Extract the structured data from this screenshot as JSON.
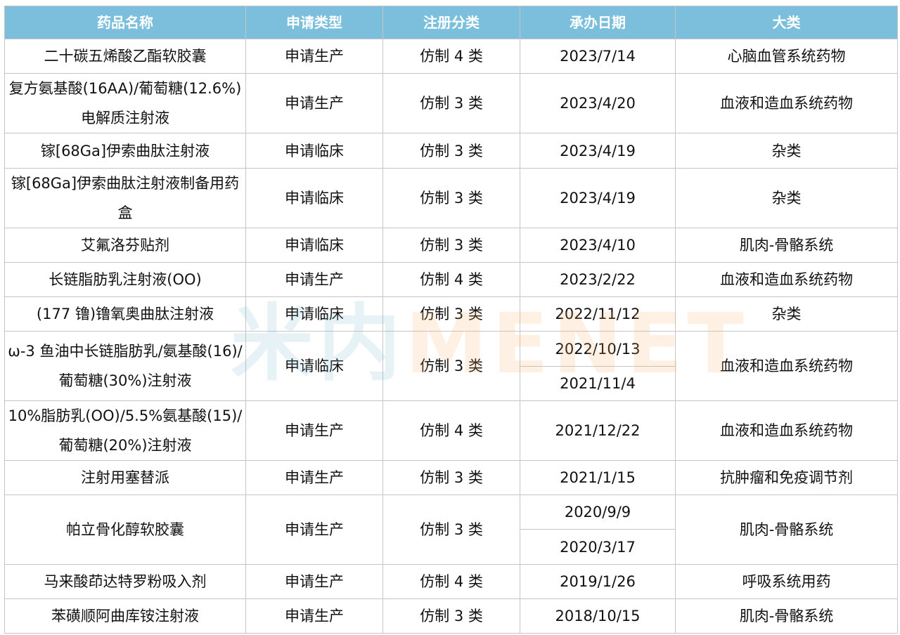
{
  "headers": [
    "药品名称",
    "申请类型",
    "注册分类",
    "承办日期",
    "大类"
  ],
  "rows": [
    {
      "name": "二十碳五烯酸乙酯软胶囊",
      "type": "申请生产",
      "class": "仿制 4 类",
      "dates": [
        "2023/7/14"
      ],
      "category": "心脑血管系统药物"
    },
    {
      "name": "复方氨基酸(16AA)/葡萄糖(12.6%)电解质注射液",
      "type": "申请生产",
      "class": "仿制 3 类",
      "dates": [
        "2023/4/20"
      ],
      "category": "血液和造血系统药物"
    },
    {
      "name": "镓[68Ga]伊索曲肽注射液",
      "type": "申请临床",
      "class": "仿制 3 类",
      "dates": [
        "2023/4/19"
      ],
      "category": "杂类"
    },
    {
      "name": "镓[68Ga]伊索曲肽注射液制备用药盒",
      "type": "申请临床",
      "class": "仿制 3 类",
      "dates": [
        "2023/4/19"
      ],
      "category": "杂类"
    },
    {
      "name": "艾氟洛芬贴剂",
      "type": "申请临床",
      "class": "仿制 3 类",
      "dates": [
        "2023/4/10"
      ],
      "category": "肌肉-骨骼系统"
    },
    {
      "name": "长链脂肪乳注射液(OO)",
      "type": "申请生产",
      "class": "仿制 4 类",
      "dates": [
        "2023/2/22"
      ],
      "category": "血液和造血系统药物"
    },
    {
      "name": "(177 镥)镥氧奥曲肽注射液",
      "type": "申请临床",
      "class": "仿制 3 类",
      "dates": [
        "2022/11/12"
      ],
      "category": "杂类"
    },
    {
      "name": "ω-3 鱼油中长链脂肪乳/氨基酸(16)/葡萄糖(30%)注射液",
      "type": "申请临床",
      "class": "仿制 3 类",
      "dates": [
        "2022/10/13",
        "2021/11/4"
      ],
      "category": "血液和造血系统药物"
    },
    {
      "name": "10%脂肪乳(OO)/5.5%氨基酸(15)/葡萄糖(20%)注射液",
      "type": "申请生产",
      "class": "仿制 4 类",
      "dates": [
        "2021/12/22"
      ],
      "category": "血液和造血系统药物"
    },
    {
      "name": "注射用塞替派",
      "type": "申请生产",
      "class": "仿制 3 类",
      "dates": [
        "2021/1/15"
      ],
      "category": "抗肿瘤和免疫调节剂"
    },
    {
      "name": "帕立骨化醇软胶囊",
      "type": "申请生产",
      "class": "仿制 3 类",
      "dates": [
        "2020/9/9",
        "2020/3/17"
      ],
      "category": "肌肉-骨骼系统"
    },
    {
      "name": "马来酸茚达特罗粉吸入剂",
      "type": "申请生产",
      "class": "仿制 4 类",
      "dates": [
        "2019/1/26"
      ],
      "category": "呼吸系统用药"
    },
    {
      "name": "苯磺顺阿曲库铵注射液",
      "type": "申请生产",
      "class": "仿制 3 类",
      "dates": [
        "2018/10/15"
      ],
      "category": "肌肉-骨骼系统"
    }
  ],
  "watermark": {
    "part1": "米内",
    "part2": "MENET"
  },
  "colors": {
    "header_bg": "#7bbfdc",
    "header_text": "#ffffff",
    "border": "#c5c5c5"
  }
}
